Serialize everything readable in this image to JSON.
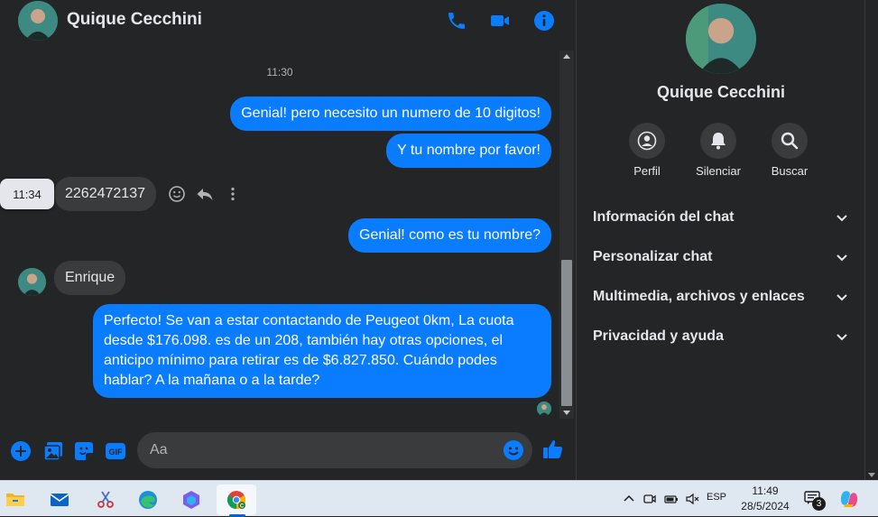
{
  "header": {
    "name": "Quique Cecchini",
    "call_icon": "phone-icon",
    "video_icon": "video-camera-icon",
    "info_icon": "info-icon"
  },
  "messages": {
    "timestamp_1": "11:30",
    "hover_time": "11:34",
    "items": [
      {
        "direction": "outgoing",
        "text": "Genial! pero necesito un numero de 10 digitos!"
      },
      {
        "direction": "outgoing",
        "text": "Y tu nombre por favor!"
      },
      {
        "direction": "incoming",
        "text": "2262472137"
      },
      {
        "direction": "outgoing",
        "text": "Genial! como es tu nombre?"
      },
      {
        "direction": "incoming",
        "text": "Enrique"
      },
      {
        "direction": "outgoing",
        "text": "Perfecto!  Se van a estar contactando de Peugeot 0km, La cuota desde $176.098. es de un 208, también hay otras opciones, el anticipo mínimo para retirar es de $6.827.850. Cuándo podes hablar? A la mañana o a la tarde?"
      }
    ]
  },
  "composer": {
    "placeholder": "Aa"
  },
  "panel": {
    "name": "Quique Cecchini",
    "actions": [
      {
        "label": "Perfil",
        "icon": "profile-icon"
      },
      {
        "label": "Silenciar",
        "icon": "bell-icon"
      },
      {
        "label": "Buscar",
        "icon": "search-icon"
      }
    ],
    "sections": [
      {
        "label": "Información del chat"
      },
      {
        "label": "Personalizar chat"
      },
      {
        "label": "Multimedia, archivos y enlaces"
      },
      {
        "label": "Privacidad y ayuda"
      }
    ]
  },
  "taskbar": {
    "language": "ESP",
    "time": "11:49",
    "date": "28/5/2024",
    "notification_count": "3"
  },
  "colors": {
    "accent": "#0a7cff",
    "background": "#242526",
    "incoming_bubble": "#3a3b3c",
    "text": "#e4e6eb",
    "taskbar": "#dfe7f1"
  }
}
